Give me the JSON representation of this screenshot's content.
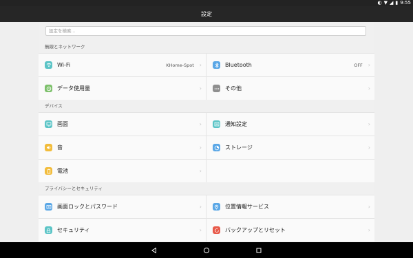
{
  "statusbar": {
    "time": "9:55"
  },
  "titlebar": {
    "title": "設定"
  },
  "search": {
    "placeholder": "設定を検索..."
  },
  "sections": [
    {
      "header": "無線とネットワーク",
      "items": [
        {
          "label": "Wi-Fi",
          "value": "KHome-Spot",
          "icon": "wifi-icon",
          "color": "#5bc4c6"
        },
        {
          "label": "Bluetooth",
          "value": "OFF",
          "icon": "bluetooth-icon",
          "color": "#5aa7e6"
        },
        {
          "label": "データ使用量",
          "value": "",
          "icon": "data-usage-icon",
          "color": "#7cc06a"
        },
        {
          "label": "その他",
          "value": "",
          "icon": "more-icon",
          "color": "#8f8f8f"
        }
      ]
    },
    {
      "header": "デバイス",
      "items": [
        {
          "label": "画面",
          "value": "",
          "icon": "display-icon",
          "color": "#5bc4c6"
        },
        {
          "label": "通知設定",
          "value": "",
          "icon": "notification-icon",
          "color": "#5bc4c6"
        },
        {
          "label": "音",
          "value": "",
          "icon": "sound-icon",
          "color": "#f2bc3b"
        },
        {
          "label": "ストレージ",
          "value": "",
          "icon": "storage-icon",
          "color": "#5aa7e6"
        },
        {
          "label": "電池",
          "value": "",
          "icon": "battery-icon",
          "color": "#f2bc3b"
        }
      ]
    },
    {
      "header": "プライバシーとセキュリティ",
      "items": [
        {
          "label": "画面ロックとパスワード",
          "value": "",
          "icon": "screen-lock-icon",
          "color": "#5aa7e6"
        },
        {
          "label": "位置情報サービス",
          "value": "",
          "icon": "location-icon",
          "color": "#5aa7e6"
        },
        {
          "label": "セキュリティ",
          "value": "",
          "icon": "security-icon",
          "color": "#5bc4c6"
        },
        {
          "label": "バックアップとリセット",
          "value": "",
          "icon": "backup-reset-icon",
          "color": "#e85a4a"
        }
      ]
    }
  ]
}
